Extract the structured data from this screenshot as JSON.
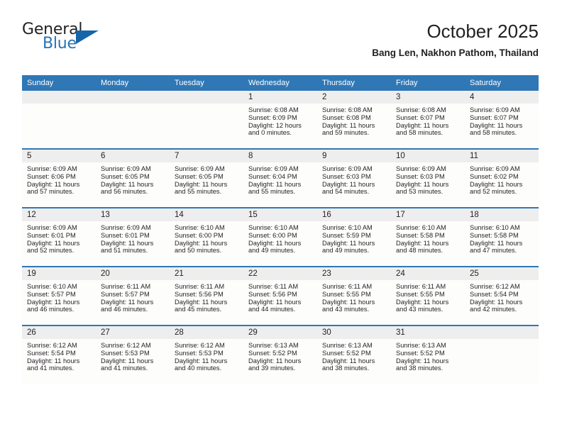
{
  "brand": {
    "name_top": "General",
    "name_bottom": "Blue",
    "triangle_color": "#1565a8",
    "blue_text_color": "#2574b8"
  },
  "header": {
    "title": "October 2025",
    "subtitle": "Bang Len, Nakhon Pathom, Thailand"
  },
  "theme": {
    "header_blue": "#3077b5",
    "daynum_band": "#eeeeee",
    "cell_bg": "#fdfdfc",
    "text": "#231f20"
  },
  "labels": {
    "sunrise_prefix": "Sunrise:",
    "sunset_prefix": "Sunset:",
    "daylight_prefix": "Daylight:"
  },
  "weekdays": [
    "Sunday",
    "Monday",
    "Tuesday",
    "Wednesday",
    "Thursday",
    "Friday",
    "Saturday"
  ],
  "weeks": [
    [
      {
        "day": "",
        "sunrise": "",
        "sunset": "",
        "daylight_line1": "",
        "daylight_line2": ""
      },
      {
        "day": "",
        "sunrise": "",
        "sunset": "",
        "daylight_line1": "",
        "daylight_line2": ""
      },
      {
        "day": "",
        "sunrise": "",
        "sunset": "",
        "daylight_line1": "",
        "daylight_line2": ""
      },
      {
        "day": "1",
        "sunrise": "Sunrise: 6:08 AM",
        "sunset": "Sunset: 6:09 PM",
        "daylight_line1": "Daylight: 12 hours",
        "daylight_line2": "and 0 minutes."
      },
      {
        "day": "2",
        "sunrise": "Sunrise: 6:08 AM",
        "sunset": "Sunset: 6:08 PM",
        "daylight_line1": "Daylight: 11 hours",
        "daylight_line2": "and 59 minutes."
      },
      {
        "day": "3",
        "sunrise": "Sunrise: 6:08 AM",
        "sunset": "Sunset: 6:07 PM",
        "daylight_line1": "Daylight: 11 hours",
        "daylight_line2": "and 58 minutes."
      },
      {
        "day": "4",
        "sunrise": "Sunrise: 6:09 AM",
        "sunset": "Sunset: 6:07 PM",
        "daylight_line1": "Daylight: 11 hours",
        "daylight_line2": "and 58 minutes."
      }
    ],
    [
      {
        "day": "5",
        "sunrise": "Sunrise: 6:09 AM",
        "sunset": "Sunset: 6:06 PM",
        "daylight_line1": "Daylight: 11 hours",
        "daylight_line2": "and 57 minutes."
      },
      {
        "day": "6",
        "sunrise": "Sunrise: 6:09 AM",
        "sunset": "Sunset: 6:05 PM",
        "daylight_line1": "Daylight: 11 hours",
        "daylight_line2": "and 56 minutes."
      },
      {
        "day": "7",
        "sunrise": "Sunrise: 6:09 AM",
        "sunset": "Sunset: 6:05 PM",
        "daylight_line1": "Daylight: 11 hours",
        "daylight_line2": "and 55 minutes."
      },
      {
        "day": "8",
        "sunrise": "Sunrise: 6:09 AM",
        "sunset": "Sunset: 6:04 PM",
        "daylight_line1": "Daylight: 11 hours",
        "daylight_line2": "and 55 minutes."
      },
      {
        "day": "9",
        "sunrise": "Sunrise: 6:09 AM",
        "sunset": "Sunset: 6:03 PM",
        "daylight_line1": "Daylight: 11 hours",
        "daylight_line2": "and 54 minutes."
      },
      {
        "day": "10",
        "sunrise": "Sunrise: 6:09 AM",
        "sunset": "Sunset: 6:03 PM",
        "daylight_line1": "Daylight: 11 hours",
        "daylight_line2": "and 53 minutes."
      },
      {
        "day": "11",
        "sunrise": "Sunrise: 6:09 AM",
        "sunset": "Sunset: 6:02 PM",
        "daylight_line1": "Daylight: 11 hours",
        "daylight_line2": "and 52 minutes."
      }
    ],
    [
      {
        "day": "12",
        "sunrise": "Sunrise: 6:09 AM",
        "sunset": "Sunset: 6:01 PM",
        "daylight_line1": "Daylight: 11 hours",
        "daylight_line2": "and 52 minutes."
      },
      {
        "day": "13",
        "sunrise": "Sunrise: 6:09 AM",
        "sunset": "Sunset: 6:01 PM",
        "daylight_line1": "Daylight: 11 hours",
        "daylight_line2": "and 51 minutes."
      },
      {
        "day": "14",
        "sunrise": "Sunrise: 6:10 AM",
        "sunset": "Sunset: 6:00 PM",
        "daylight_line1": "Daylight: 11 hours",
        "daylight_line2": "and 50 minutes."
      },
      {
        "day": "15",
        "sunrise": "Sunrise: 6:10 AM",
        "sunset": "Sunset: 6:00 PM",
        "daylight_line1": "Daylight: 11 hours",
        "daylight_line2": "and 49 minutes."
      },
      {
        "day": "16",
        "sunrise": "Sunrise: 6:10 AM",
        "sunset": "Sunset: 5:59 PM",
        "daylight_line1": "Daylight: 11 hours",
        "daylight_line2": "and 49 minutes."
      },
      {
        "day": "17",
        "sunrise": "Sunrise: 6:10 AM",
        "sunset": "Sunset: 5:58 PM",
        "daylight_line1": "Daylight: 11 hours",
        "daylight_line2": "and 48 minutes."
      },
      {
        "day": "18",
        "sunrise": "Sunrise: 6:10 AM",
        "sunset": "Sunset: 5:58 PM",
        "daylight_line1": "Daylight: 11 hours",
        "daylight_line2": "and 47 minutes."
      }
    ],
    [
      {
        "day": "19",
        "sunrise": "Sunrise: 6:10 AM",
        "sunset": "Sunset: 5:57 PM",
        "daylight_line1": "Daylight: 11 hours",
        "daylight_line2": "and 46 minutes."
      },
      {
        "day": "20",
        "sunrise": "Sunrise: 6:11 AM",
        "sunset": "Sunset: 5:57 PM",
        "daylight_line1": "Daylight: 11 hours",
        "daylight_line2": "and 46 minutes."
      },
      {
        "day": "21",
        "sunrise": "Sunrise: 6:11 AM",
        "sunset": "Sunset: 5:56 PM",
        "daylight_line1": "Daylight: 11 hours",
        "daylight_line2": "and 45 minutes."
      },
      {
        "day": "22",
        "sunrise": "Sunrise: 6:11 AM",
        "sunset": "Sunset: 5:56 PM",
        "daylight_line1": "Daylight: 11 hours",
        "daylight_line2": "and 44 minutes."
      },
      {
        "day": "23",
        "sunrise": "Sunrise: 6:11 AM",
        "sunset": "Sunset: 5:55 PM",
        "daylight_line1": "Daylight: 11 hours",
        "daylight_line2": "and 43 minutes."
      },
      {
        "day": "24",
        "sunrise": "Sunrise: 6:11 AM",
        "sunset": "Sunset: 5:55 PM",
        "daylight_line1": "Daylight: 11 hours",
        "daylight_line2": "and 43 minutes."
      },
      {
        "day": "25",
        "sunrise": "Sunrise: 6:12 AM",
        "sunset": "Sunset: 5:54 PM",
        "daylight_line1": "Daylight: 11 hours",
        "daylight_line2": "and 42 minutes."
      }
    ],
    [
      {
        "day": "26",
        "sunrise": "Sunrise: 6:12 AM",
        "sunset": "Sunset: 5:54 PM",
        "daylight_line1": "Daylight: 11 hours",
        "daylight_line2": "and 41 minutes."
      },
      {
        "day": "27",
        "sunrise": "Sunrise: 6:12 AM",
        "sunset": "Sunset: 5:53 PM",
        "daylight_line1": "Daylight: 11 hours",
        "daylight_line2": "and 41 minutes."
      },
      {
        "day": "28",
        "sunrise": "Sunrise: 6:12 AM",
        "sunset": "Sunset: 5:53 PM",
        "daylight_line1": "Daylight: 11 hours",
        "daylight_line2": "and 40 minutes."
      },
      {
        "day": "29",
        "sunrise": "Sunrise: 6:13 AM",
        "sunset": "Sunset: 5:52 PM",
        "daylight_line1": "Daylight: 11 hours",
        "daylight_line2": "and 39 minutes."
      },
      {
        "day": "30",
        "sunrise": "Sunrise: 6:13 AM",
        "sunset": "Sunset: 5:52 PM",
        "daylight_line1": "Daylight: 11 hours",
        "daylight_line2": "and 38 minutes."
      },
      {
        "day": "31",
        "sunrise": "Sunrise: 6:13 AM",
        "sunset": "Sunset: 5:52 PM",
        "daylight_line1": "Daylight: 11 hours",
        "daylight_line2": "and 38 minutes."
      },
      {
        "day": "",
        "sunrise": "",
        "sunset": "",
        "daylight_line1": "",
        "daylight_line2": ""
      }
    ]
  ]
}
